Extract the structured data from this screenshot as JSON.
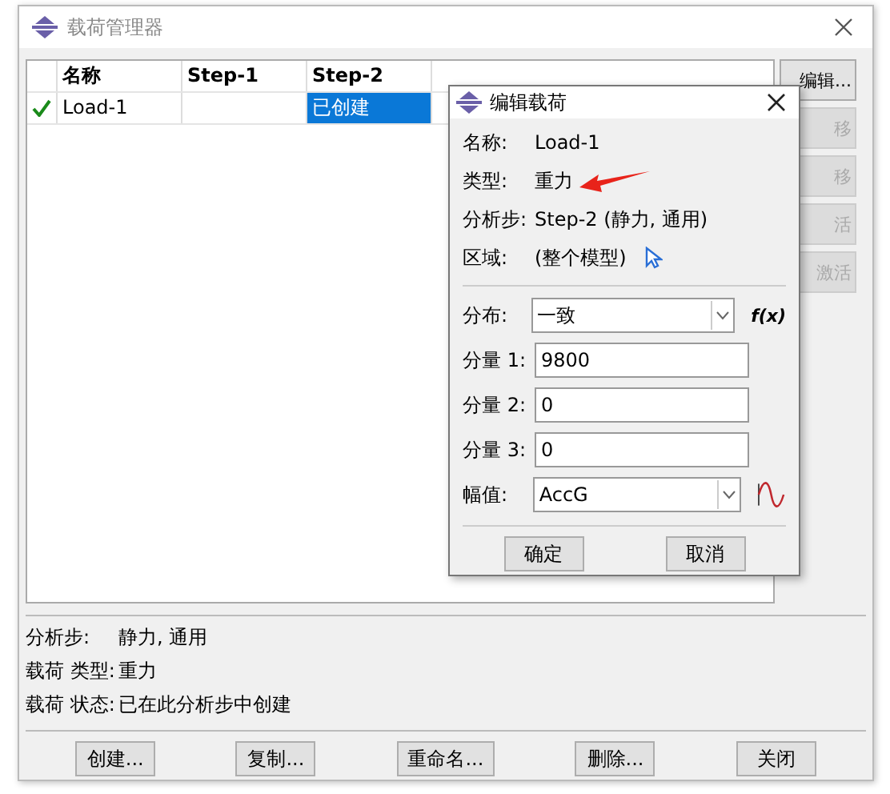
{
  "window": {
    "title": "载荷管理器"
  },
  "table": {
    "columns": [
      "名称",
      "Step-1",
      "Step-2"
    ],
    "rows": [
      {
        "checked": true,
        "cells": [
          {
            "text": "Load-1",
            "selected": false
          },
          {
            "text": "",
            "selected": false
          },
          {
            "text": "已创建",
            "selected": true
          }
        ]
      }
    ]
  },
  "side_buttons": [
    {
      "label": "编辑...",
      "disabled": false
    },
    {
      "label": "移",
      "disabled": true
    },
    {
      "label": "移",
      "disabled": true
    },
    {
      "label": "活",
      "disabled": true
    },
    {
      "label": "激活",
      "disabled": true
    }
  ],
  "info": [
    {
      "label": "分析步:",
      "value": "静力, 通用"
    },
    {
      "label": "载荷 类型:",
      "value": "重力"
    },
    {
      "label": "载荷 状态:",
      "value": "已在此分析步中创建"
    }
  ],
  "buttons": [
    "创建...",
    "复制...",
    "重命名...",
    "删除...",
    "关闭"
  ],
  "dialog": {
    "title": "编辑载荷",
    "props": [
      {
        "label": "名称:",
        "value": "Load-1"
      },
      {
        "label": "类型:",
        "value": "重力",
        "arrow": true
      },
      {
        "label": "分析步:",
        "value": "Step-2 (静力, 通用)"
      },
      {
        "label": "区域:",
        "value": "(整个模型)",
        "pick": true
      }
    ],
    "fields": [
      {
        "kind": "combo",
        "label": "分布:",
        "value": "一致",
        "function_label": "f(x)"
      },
      {
        "kind": "text",
        "label": "分量 1:",
        "value": "9800"
      },
      {
        "kind": "text",
        "label": "分量 2:",
        "value": "0"
      },
      {
        "kind": "text",
        "label": "分量 3:",
        "value": "0"
      },
      {
        "kind": "combo",
        "label": "幅值:",
        "value": "AccG",
        "amplitude_icon": true
      }
    ],
    "buttons": [
      "确定",
      "取消"
    ]
  }
}
